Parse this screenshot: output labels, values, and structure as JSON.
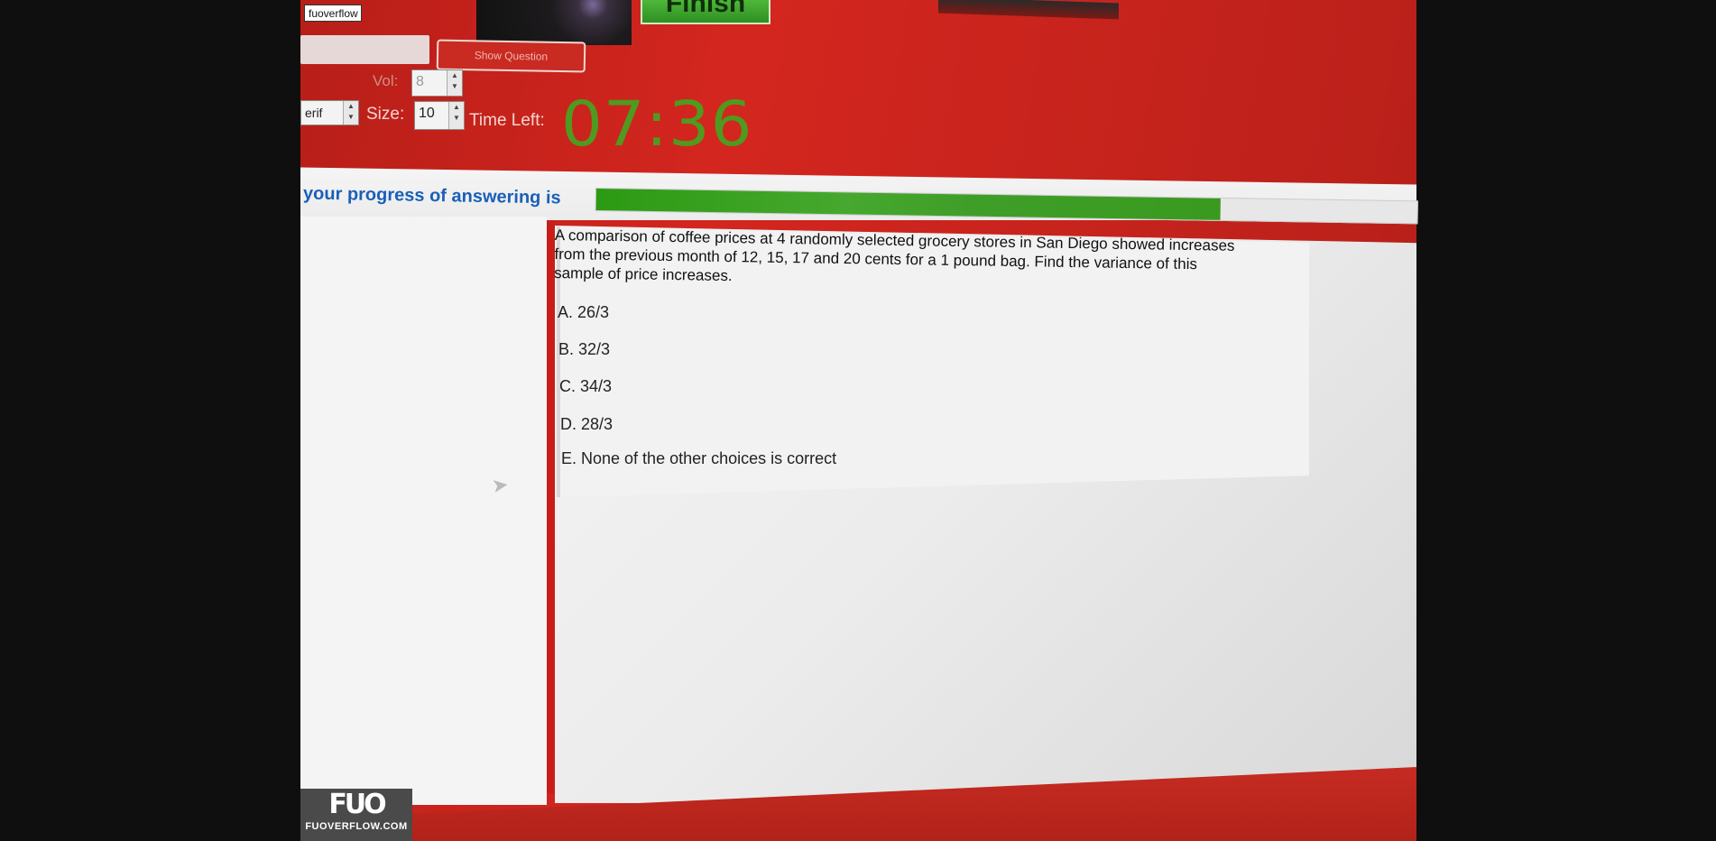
{
  "top": {
    "tag_label": "fuoverflow",
    "show_question_label": "Show Question",
    "finish_label": "Finish"
  },
  "controls": {
    "vol_label": "Vol:",
    "vol_value": "8",
    "font_value": "erif",
    "size_label": "Size:",
    "size_value": "10",
    "time_left_label": "Time Left:",
    "timer": "07:36"
  },
  "progress": {
    "label": "your progress of answering is",
    "fraction": 0.76
  },
  "question": {
    "text": "A comparison of coffee prices at 4 randomly selected grocery stores in San Diego showed increases from the previous month of 12, 15, 17 and 20 cents for a 1 pound bag. Find the variance of this sample of price increases.",
    "choices": [
      "A.  26/3",
      "B.  32/3",
      "C.  34/3",
      "D.  28/3",
      "E.  None of the other choices is correct"
    ]
  },
  "watermark": {
    "logo_mark": "FUO",
    "logo_text": "FUOVERFLOW.COM"
  }
}
